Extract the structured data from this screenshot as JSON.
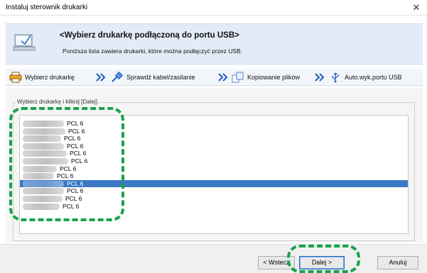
{
  "window": {
    "title": "Instaluj sterownik drukarki",
    "close_glyph": "✕"
  },
  "header": {
    "title": "<Wybierz drukarkę podłączoną do portu USB>",
    "subtitle": "Poniższa lista zawiera drukarki, które można podłączyć przez USB.",
    "icon": "wizard-monitor-icon"
  },
  "steps": [
    {
      "label": "Wybierz drukarkę",
      "icon": "printer-icon"
    },
    {
      "label": "Sprawdź kabel/zasilanie",
      "icon": "plug-cable-icon"
    },
    {
      "label": "Kopiowanie plików",
      "icon": "copy-files-icon"
    },
    {
      "label": "Auto.wyk.portu USB",
      "icon": "usb-icon"
    }
  ],
  "list": {
    "group_label": "Wybierz drukarkę i kliknij [Dalej].",
    "rows": [
      {
        "suffix": "PCL 6",
        "selected": false
      },
      {
        "suffix": "PCL 6",
        "selected": false
      },
      {
        "suffix": "PCL 6",
        "selected": false
      },
      {
        "suffix": "PCL 6",
        "selected": false
      },
      {
        "suffix": "PCL 6",
        "selected": false
      },
      {
        "suffix": "PCL 6",
        "selected": false
      },
      {
        "suffix": "PCL 6",
        "selected": false
      },
      {
        "suffix": "PCL 6",
        "selected": false
      },
      {
        "suffix": "PCL 6",
        "selected": true
      },
      {
        "suffix": "PCL 6",
        "selected": false
      },
      {
        "suffix": "PCL 6",
        "selected": false
      },
      {
        "suffix": "PCL 6",
        "selected": false
      }
    ]
  },
  "buttons": {
    "back": "< Wstecz",
    "next": "Dalej >",
    "cancel": "Anuluj"
  },
  "colors": {
    "header_bg": "#e3ecf6",
    "selection": "#3a78c4",
    "callout": "#17a34a"
  }
}
